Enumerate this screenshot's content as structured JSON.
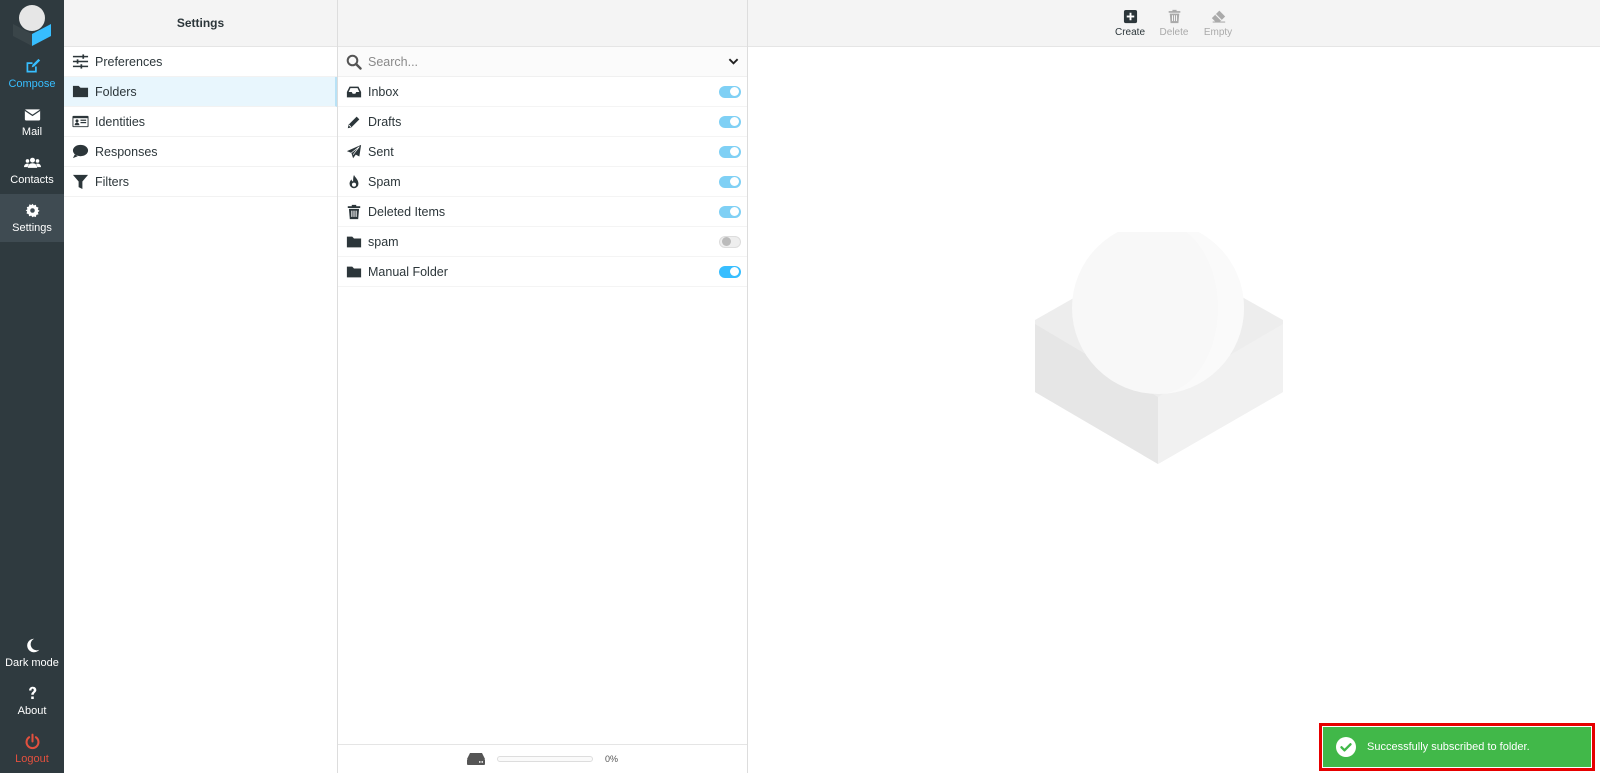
{
  "taskmenu": {
    "items": [
      {
        "id": "compose",
        "label": "Compose",
        "icon": "compose-icon"
      },
      {
        "id": "mail",
        "label": "Mail",
        "icon": "envelope-icon"
      },
      {
        "id": "contacts",
        "label": "Contacts",
        "icon": "users-icon"
      },
      {
        "id": "settings",
        "label": "Settings",
        "icon": "gear-icon",
        "selected": true
      }
    ],
    "bottom_items": [
      {
        "id": "darkmode",
        "label": "Dark mode",
        "icon": "moon-icon"
      },
      {
        "id": "about",
        "label": "About",
        "icon": "question-icon"
      },
      {
        "id": "logout",
        "label": "Logout",
        "icon": "power-icon"
      }
    ]
  },
  "settings": {
    "title": "Settings",
    "items": [
      {
        "label": "Preferences",
        "icon": "sliders-icon"
      },
      {
        "label": "Folders",
        "icon": "folder-icon",
        "selected": true
      },
      {
        "label": "Identities",
        "icon": "id-card-icon"
      },
      {
        "label": "Responses",
        "icon": "comment-icon"
      },
      {
        "label": "Filters",
        "icon": "filter-icon"
      }
    ]
  },
  "folders": {
    "search_placeholder": "Search...",
    "items": [
      {
        "name": "Inbox",
        "icon": "inbox-icon",
        "subscribed": true
      },
      {
        "name": "Drafts",
        "icon": "pencil-icon",
        "subscribed": true
      },
      {
        "name": "Sent",
        "icon": "paper-plane-icon",
        "subscribed": true
      },
      {
        "name": "Spam",
        "icon": "fire-icon",
        "subscribed": true
      },
      {
        "name": "Deleted Items",
        "icon": "trash-icon",
        "subscribed": true
      },
      {
        "name": "spam",
        "icon": "folder-icon",
        "subscribed": false
      },
      {
        "name": "Manual Folder",
        "icon": "folder-icon",
        "subscribed": true
      }
    ],
    "quota": {
      "percent": 0,
      "label": "0%"
    }
  },
  "toolbar": {
    "create_label": "Create",
    "delete_label": "Delete",
    "empty_label": "Empty"
  },
  "toast": {
    "message": "Successfully subscribed to folder.",
    "type": "success",
    "color": "#41b849"
  },
  "colors": {
    "accent": "#37beff",
    "taskmenu_bg": "#2f3a3f",
    "logout": "#e3503e"
  }
}
